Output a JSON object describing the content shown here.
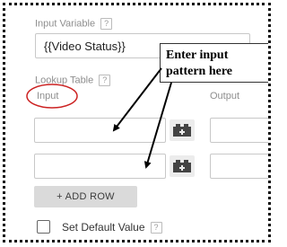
{
  "input_variable": {
    "label": "Input Variable",
    "help": "?",
    "value": "{{Video Status}}"
  },
  "lookup_table": {
    "label": "Lookup Table",
    "help": "?",
    "input_header": "Input",
    "output_header": "Output",
    "rows": [
      {
        "input": "",
        "output": ""
      },
      {
        "input": "",
        "output": ""
      }
    ],
    "add_row_label": "+ ADD ROW"
  },
  "default_value": {
    "label": "Set Default Value",
    "help": "?",
    "checked": false
  },
  "annotation": {
    "callout_text": "Enter input\npattern here",
    "highlight_color": "#cc2222",
    "arrow_color": "#000000"
  }
}
